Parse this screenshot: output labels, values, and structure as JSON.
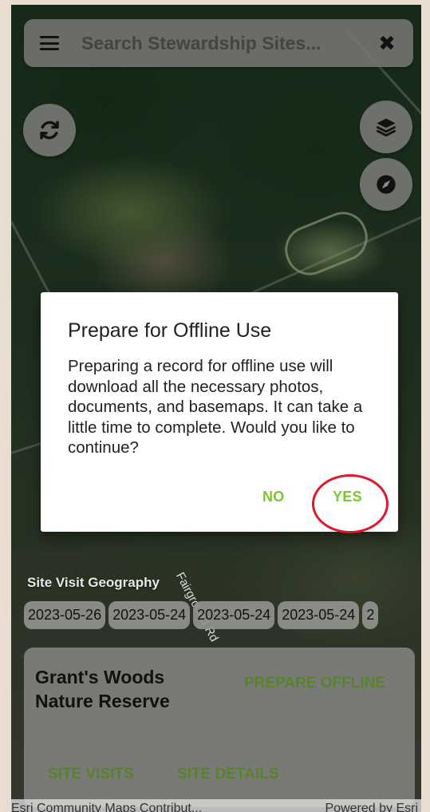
{
  "search": {
    "placeholder": "Search Stewardship Sites...",
    "clear_label": "✖"
  },
  "dialog": {
    "title": "Prepare for Offline Use",
    "body": "Preparing a record for offline use will download all the necessary photos, documents, and basemaps. It can take a little time to complete. Would you like to continue?",
    "no_label": "NO",
    "yes_label": "YES"
  },
  "map": {
    "section_label": "Site Visit Geography",
    "road_label": "Fairground Rd",
    "visit_dates": [
      "2023-05-26",
      "2023-05-24",
      "2023-05-24",
      "2023-05-24",
      "2"
    ]
  },
  "site_card": {
    "name": "Grant's Woods Nature Reserve",
    "prepare_offline_label": "PREPARE OFFLINE",
    "site_visits_label": "SITE VISITS",
    "site_details_label": "SITE DETAILS"
  },
  "attribution": {
    "left": "Esri Community Maps Contribut...",
    "right": "Powered by Esri"
  },
  "colors": {
    "accent_green": "#7cc431",
    "card_green": "#58832c",
    "highlight_red": "#e0162b"
  },
  "icons": [
    "menu-icon",
    "close-icon",
    "refresh-icon",
    "layers-icon",
    "compass-icon"
  ]
}
